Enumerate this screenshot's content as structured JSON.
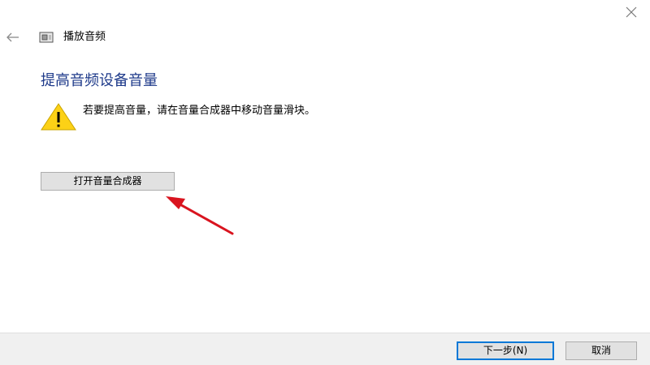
{
  "window": {
    "title": "播放音频",
    "close_icon": "close-icon",
    "back_icon": "back-arrow-icon",
    "title_icon": "speaker-device-icon"
  },
  "main": {
    "heading": "提高音频设备音量",
    "warning_icon": "warning-icon",
    "warning_text": "若要提高音量，请在音量合成器中移动音量滑块。",
    "mixer_button_label": "打开音量合成器",
    "annotation_icon": "red-pointer-arrow-icon"
  },
  "footer": {
    "next_label": "下一步(N)",
    "cancel_label": "取消"
  },
  "colors": {
    "heading": "#1e3a8a",
    "warning_fill": "#fcd116",
    "annotation_arrow": "#d9141f",
    "primary_button_border": "#0078d7",
    "footer_background": "#f0f0f0"
  }
}
